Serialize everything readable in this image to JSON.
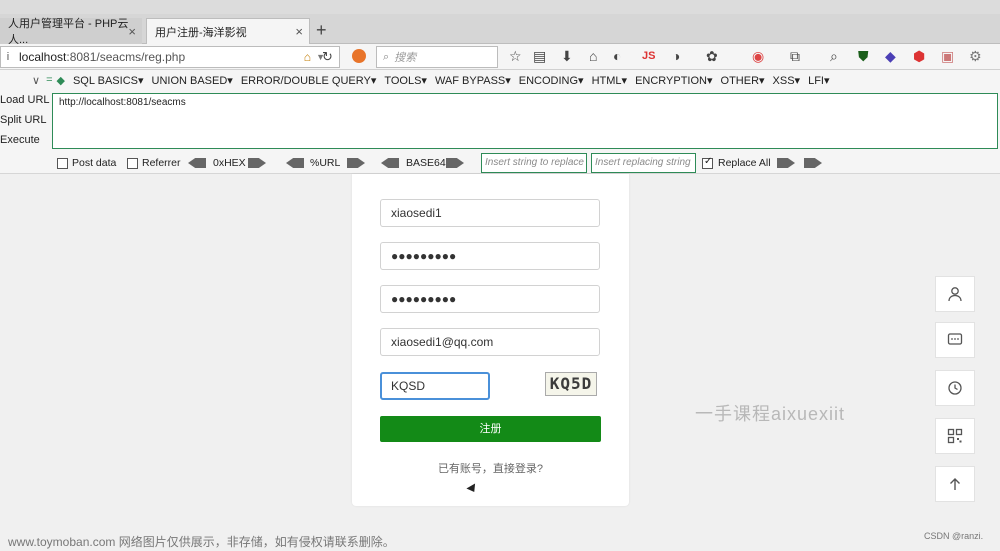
{
  "tabs": [
    {
      "label": "人用户管理平台 - PHP云人...",
      "close": "×"
    },
    {
      "label": "用户注册-海洋影视",
      "close": "×"
    }
  ],
  "new_tab": "+",
  "address": {
    "info_icon": "i",
    "host": "localhost",
    "path": ":8081/seacms/reg.php"
  },
  "search": {
    "placeholder": "搜索"
  },
  "hackbar": {
    "menu": [
      "SQL BASICS▾",
      "UNION BASED▾",
      "ERROR/DOUBLE QUERY▾",
      "TOOLS▾",
      "WAF BYPASS▾",
      "ENCODING▾",
      "HTML▾",
      "ENCRYPTION▾",
      "OTHER▾",
      "XSS▾",
      "LFI▾"
    ],
    "load_url": "Load URL",
    "split_url": "Split URL",
    "execute": "Execute",
    "url_value": "http://localhost:8081/seacms",
    "post_data": "Post data",
    "referrer": "Referrer",
    "hex": "0xHEX",
    "url_enc": "%URL",
    "base64": "BASE64",
    "insert_placeholder": "Insert string to replace",
    "replacing_placeholder": "Insert replacing string",
    "replace_all": "Replace All",
    "replace_all_checked": true
  },
  "form": {
    "username": "xiaosedi1",
    "password": "●●●●●●●●●",
    "password_confirm": "●●●●●●●●●",
    "email": "xiaosedi1@qq.com",
    "captcha_input": "KQSD",
    "captcha_image": "KQ5D",
    "submit": "注册",
    "login_link": "已有账号，直接登录?"
  },
  "watermark": "一手课程aixuexiit",
  "footer_watermark": "www.toymoban.com 网络图片仅供展示，非存储，如有侵权请联系删除。",
  "csdn_mark": "CSDN @ranzi.",
  "float_buttons": [
    "user-icon",
    "message-icon",
    "history-icon",
    "qrcode-icon",
    "back-to-top-icon"
  ],
  "colors": {
    "submit": "#138a17",
    "hackbar_border": "#2e8b57",
    "focus": "#4a90d9"
  }
}
